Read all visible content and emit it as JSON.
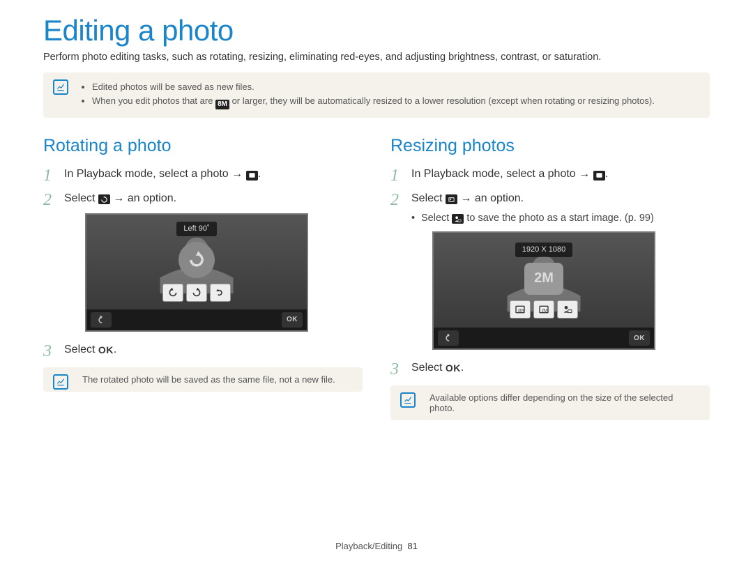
{
  "page_title": "Editing a photo",
  "intro": "Perform photo editing tasks, such as rotating, resizing, eliminating red-eyes, and adjusting brightness, contrast, or saturation.",
  "top_notes": [
    "Edited photos will be saved as new files.",
    "When you edit photos that are 8M or larger, they will be automatically resized to a lower resolution (except when rotating or resizing photos)."
  ],
  "size_8m": "8M",
  "left": {
    "heading": "Rotating a photo",
    "step1_pre": "In Playback mode, select a photo → ",
    "step2_pre": "Select ",
    "step2_post": " → an option.",
    "cam_label": "Left 90˚",
    "ok_label": "OK",
    "step3_pre": "Select ",
    "step3_ok": "OK",
    "note": "The rotated photo will be saved as the same file, not a new file."
  },
  "right": {
    "heading": "Resizing photos",
    "step1_pre": "In Playback mode, select a photo → ",
    "step2_pre": "Select ",
    "step2_post": " → an option.",
    "sub_pre": "Select ",
    "sub_post": " to save the photo as a start image. (p. 99)",
    "cam_label": "1920 X 1080",
    "size_icon_text": "2M",
    "ok_label": "OK",
    "step3_pre": "Select ",
    "step3_ok": "OK",
    "note": "Available options differ depending on the size of the selected photo."
  },
  "footer": {
    "section": "Playback/Editing",
    "page": "81"
  }
}
